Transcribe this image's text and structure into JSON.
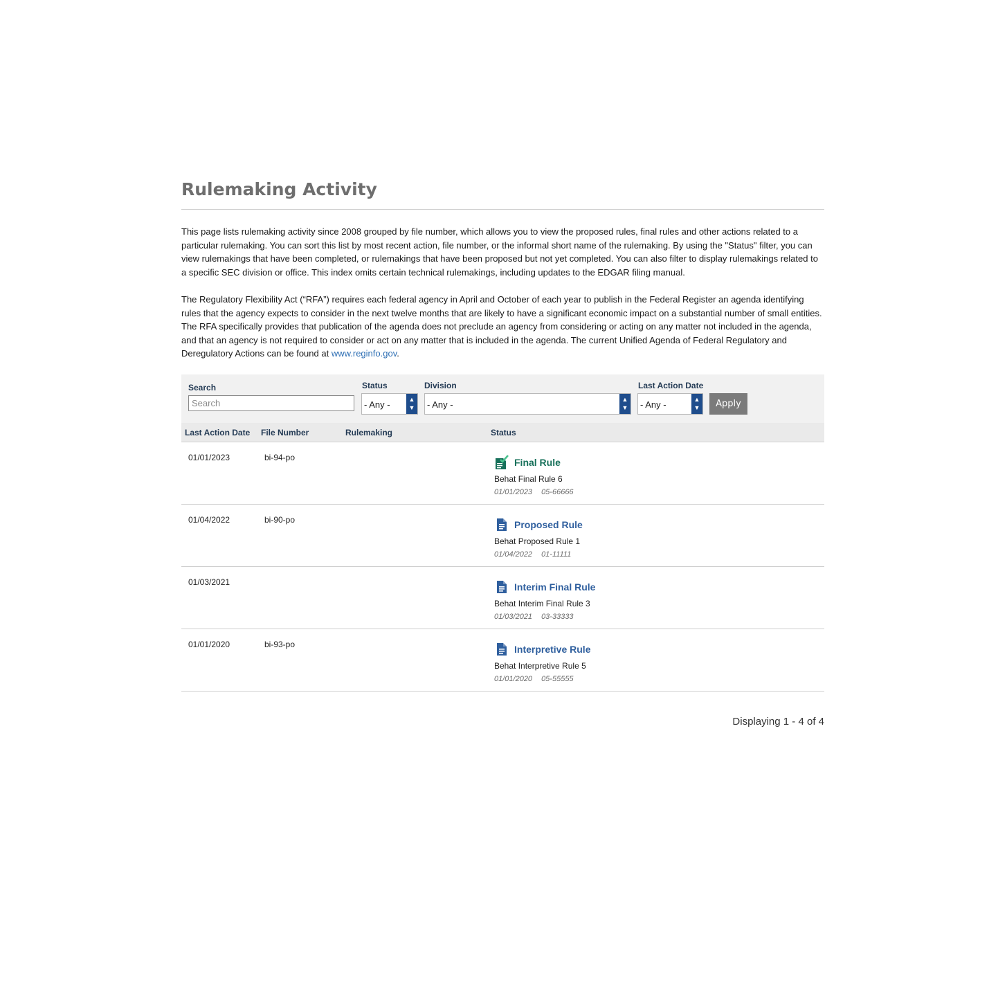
{
  "page": {
    "title": "Rulemaking Activity",
    "intro_p1": "This page lists rulemaking activity since 2008 grouped by file number, which allows you to view the proposed rules, final rules and other actions related to a particular rulemaking. You can sort this list by most recent action, file number, or the informal short name of the rulemaking. By using the \"Status\" filter, you can view rulemakings that have been completed, or rulemakings that have been proposed but not yet completed. You can also filter to display rulemakings related to a specific SEC division or office. This index omits certain technical rulemakings, including updates to the EDGAR filing manual.",
    "intro_p2_text": "The Regulatory Flexibility Act (“RFA”) requires each federal agency in April and October of each year to publish in the Federal Register an agenda identifying rules that the agency expects to consider in the next twelve months that are likely to have a significant economic impact on a substantial number of small entities. The RFA specifically provides that publication of the agenda does not preclude an agency from considering or acting on any matter not included in the agenda, and that an agency is not required to consider or act on any matter that is included in the agenda. The current Unified Agenda of Federal Regulatory and Deregulatory Actions can be found at ",
    "intro_p2_link": "www.reginfo.gov",
    "intro_p2_end": "."
  },
  "filters": {
    "search_label": "Search",
    "search_placeholder": "Search",
    "search_value": "",
    "status_label": "Status",
    "status_value": "- Any -",
    "division_label": "Division",
    "division_value": "- Any -",
    "last_action_label": "Last Action Date",
    "last_action_value": "- Any -",
    "apply_label": "Apply"
  },
  "table": {
    "columns": [
      "Last Action Date",
      "File Number",
      "Rulemaking",
      "Status"
    ],
    "rows": [
      {
        "date": "01/01/2023",
        "file": "bi-94-po",
        "status": "Final Rule",
        "status_type": "final",
        "detail": "Behat Final Rule 6",
        "meta_date": "01/01/2023",
        "meta_num": "05-66666"
      },
      {
        "date": "01/04/2022",
        "file": "bi-90-po",
        "status": "Proposed Rule",
        "status_type": "doc",
        "detail": "Behat Proposed Rule 1",
        "meta_date": "01/04/2022",
        "meta_num": "01-11111"
      },
      {
        "date": "01/03/2021",
        "file": "",
        "status": "Interim Final Rule",
        "status_type": "doc",
        "detail": "Behat Interim Final Rule 3",
        "meta_date": "01/03/2021",
        "meta_num": "03-33333"
      },
      {
        "date": "01/01/2020",
        "file": "bi-93-po",
        "status": "Interpretive Rule",
        "status_type": "doc",
        "detail": "Behat Interpretive Rule 5",
        "meta_date": "01/01/2020",
        "meta_num": "05-55555"
      }
    ]
  },
  "colors": {
    "final": "#17705a",
    "doc": "#2f5f9e",
    "select_arrows": "#1f4d8c"
  },
  "pager": {
    "summary": "Displaying 1 - 4 of 4"
  }
}
